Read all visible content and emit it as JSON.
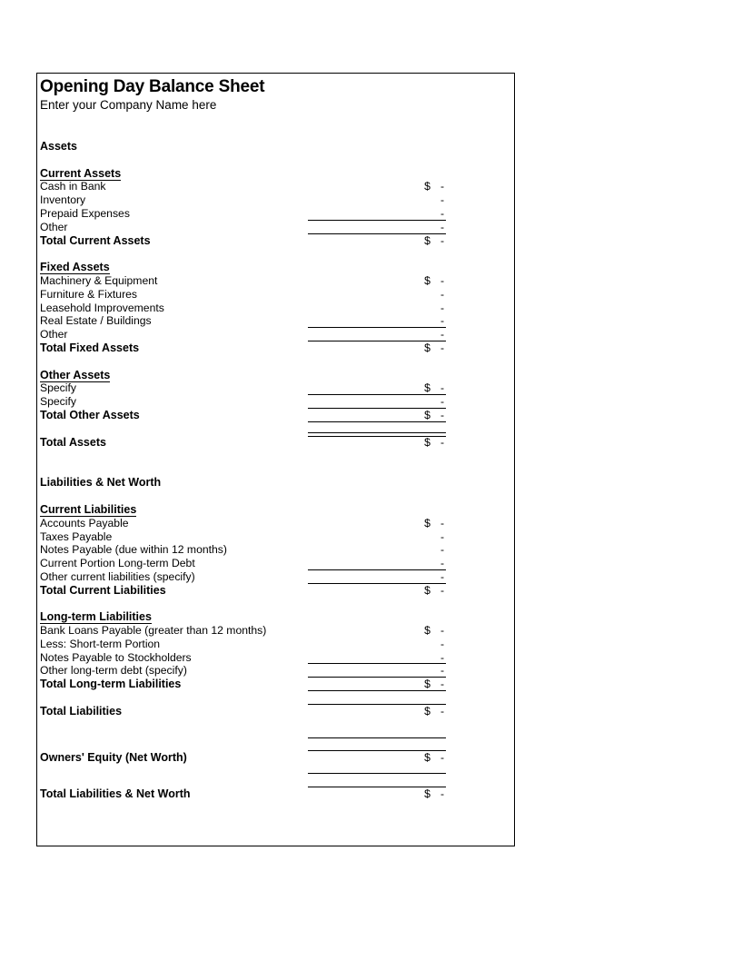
{
  "document": {
    "title": "Opening Day Balance Sheet",
    "company_placeholder": "Enter your Company Name here"
  },
  "assets": {
    "heading": "Assets",
    "groups": [
      {
        "heading": "Current Assets",
        "items": [
          {
            "label": "Cash in Bank",
            "currency": "$",
            "value": "-"
          },
          {
            "label": "Inventory",
            "currency": "",
            "value": "-"
          },
          {
            "label": "Prepaid Expenses",
            "currency": "",
            "value": "-"
          },
          {
            "label": "Other",
            "currency": "",
            "value": "-"
          }
        ],
        "total": {
          "label": "Total Current Assets",
          "currency": "$",
          "value": "-"
        }
      },
      {
        "heading": "Fixed Assets",
        "items": [
          {
            "label": "Machinery & Equipment",
            "currency": "$",
            "value": "-"
          },
          {
            "label": "Furniture & Fixtures",
            "currency": "",
            "value": "-"
          },
          {
            "label": "Leasehold Improvements",
            "currency": "",
            "value": "-"
          },
          {
            "label": "Real Estate / Buildings",
            "currency": "",
            "value": "-"
          },
          {
            "label": "Other",
            "currency": "",
            "value": "-"
          }
        ],
        "total": {
          "label": "Total Fixed Assets",
          "currency": "$",
          "value": "-"
        }
      },
      {
        "heading": "Other Assets",
        "items": [
          {
            "label": "Specify",
            "currency": "$",
            "value": "-"
          },
          {
            "label": "Specify",
            "currency": "",
            "value": "-"
          }
        ],
        "total": {
          "label": "Total Other Assets",
          "currency": "$",
          "value": "-"
        }
      }
    ],
    "grand_total": {
      "label": "Total Assets",
      "currency": "$",
      "value": "-"
    }
  },
  "liabilities": {
    "heading": "Liabilities & Net Worth",
    "groups": [
      {
        "heading": "Current Liabilities",
        "items": [
          {
            "label": "Accounts Payable",
            "currency": "$",
            "value": "-"
          },
          {
            "label": "Taxes Payable",
            "currency": "",
            "value": "-"
          },
          {
            "label": "Notes Payable (due within 12 months)",
            "currency": "",
            "value": "-"
          },
          {
            "label": "Current Portion Long-term Debt",
            "currency": "",
            "value": "-"
          },
          {
            "label": "Other current liabilities (specify)",
            "currency": "",
            "value": "-"
          }
        ],
        "total": {
          "label": "Total Current Liabilities",
          "currency": "$",
          "value": "-"
        }
      },
      {
        "heading": "Long-term Liabilities",
        "items": [
          {
            "label": "Bank Loans Payable (greater than 12 months)",
            "currency": "$",
            "value": "-"
          },
          {
            "label": "Less: Short-term Portion",
            "currency": "",
            "value": "-"
          },
          {
            "label": "Notes Payable to Stockholders",
            "currency": "",
            "value": "-"
          },
          {
            "label": "Other long-term debt (specify)",
            "currency": "",
            "value": "-"
          }
        ],
        "total": {
          "label": "Total Long-term Liabilities",
          "currency": "$",
          "value": "-"
        }
      }
    ],
    "total_liabilities": {
      "label": "Total Liabilities",
      "currency": "$",
      "value": "-"
    },
    "owners_equity": {
      "label": "Owners' Equity (Net Worth)",
      "currency": "$",
      "value": "-"
    },
    "grand_total": {
      "label": "Total Liabilities & Net Worth",
      "currency": "$",
      "value": "-"
    }
  }
}
